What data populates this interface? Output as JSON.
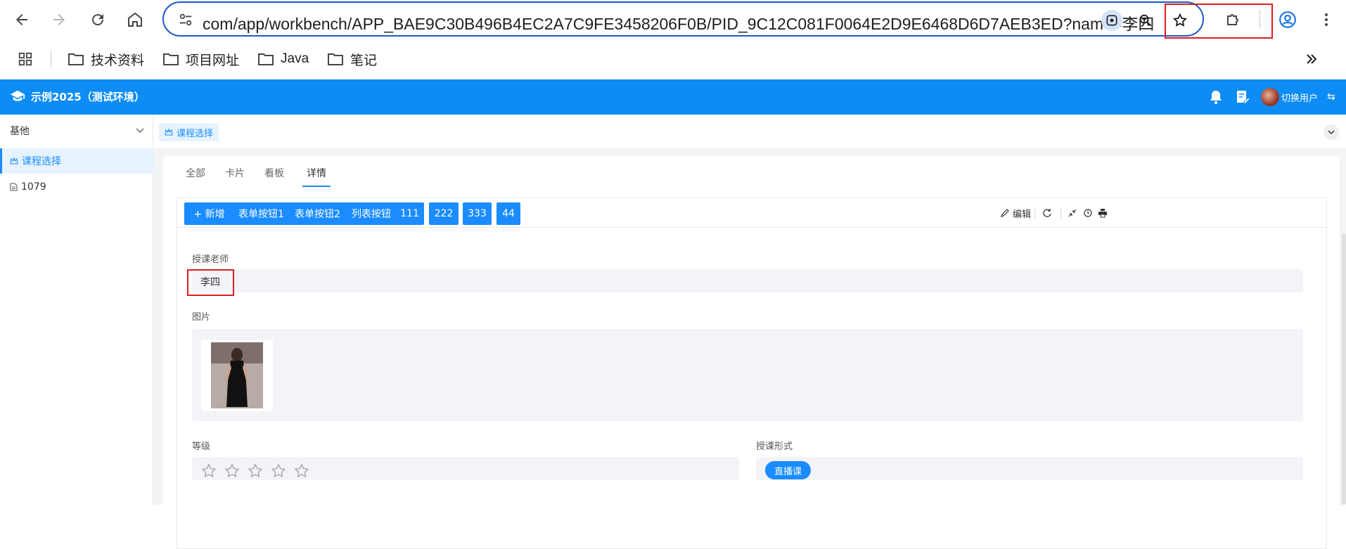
{
  "browser": {
    "url": "com/app/workbench/APP_BAE9C30B496B4EC2A7C9FE3458206F0B/PID_9C12C081F0064E2D9E6468D6D7AEB3ED?name=李四",
    "bookmarks": [
      {
        "label": "技术资料"
      },
      {
        "label": "项目网址"
      },
      {
        "label": "Java"
      },
      {
        "label": "笔记"
      }
    ]
  },
  "app": {
    "title": "示例2025（测试环境）",
    "user_label": "切换用户",
    "brand_color": "#0d8cf5",
    "accent_color": "#1a8cff",
    "highlight_color": "#d9201e"
  },
  "sidebar": {
    "group_label": "基他",
    "items": [
      {
        "label": "课程选择",
        "active": true
      },
      {
        "label": "1079",
        "active": false
      }
    ]
  },
  "page_tag": {
    "label": "课程选择"
  },
  "tabs": [
    {
      "label": "全部"
    },
    {
      "label": "卡片"
    },
    {
      "label": "看板"
    },
    {
      "label": "详情",
      "active": true
    }
  ],
  "toolbar": {
    "buttons": [
      {
        "label": "+ 新增"
      },
      {
        "label": "表单按钮1"
      },
      {
        "label": "表单按钮2"
      },
      {
        "label": "列表按钮"
      },
      {
        "label": "111"
      },
      {
        "label": "222"
      },
      {
        "label": "333"
      },
      {
        "label": "44"
      }
    ],
    "edit_label": "编辑"
  },
  "form": {
    "teacher_label": "授课老师",
    "teacher_value": "李四",
    "image_label": "图片",
    "grade_label": "等级",
    "grade_stars": 5,
    "grade_rating": 0,
    "mode_label": "授课形式",
    "mode_value": "直播课"
  }
}
